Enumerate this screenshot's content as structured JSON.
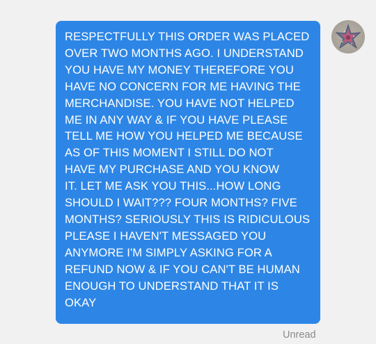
{
  "conversation": {
    "message": {
      "lines": [
        "RESPECTFULLY THIS ORDER WAS PLACED",
        "OVER TWO MONTHS AGO. I UNDERSTAND",
        "YOU HAVE MY MONEY THEREFORE YOU",
        "HAVE NO CONCERN FOR ME HAVING THE",
        "MERCHANDISE. YOU HAVE NOT HELPED",
        "ME IN ANY WAY & IF YOU HAVE PLEASE",
        "TELL ME HOW YOU HELPED ME BECAUSE",
        "AS OF THIS MOMENT I STILL DO NOT",
        "HAVE MY PURCHASE AND YOU KNOW",
        "IT. LET ME ASK YOU THIS...HOW LONG",
        "SHOULD I WAIT??? FOUR MONTHS? FIVE",
        "MONTHS? SERIOUSLY THIS IS RIDICULOUS",
        "PLEASE I HAVEN'T MESSAGED YOU",
        "ANYMORE I'M SIMPLY ASKING FOR A",
        "REFUND NOW & IF YOU CAN'T BE HUMAN",
        "ENOUGH TO UNDERSTAND THAT IT IS",
        "OKAY"
      ],
      "status": "Unread"
    },
    "avatar": {
      "icon": "starfish-avatar-icon"
    }
  },
  "colors": {
    "background": "#f1f1f1",
    "bubble": "#2d86e6",
    "bubble_text": "#ffffff",
    "status_text": "#8a8a8a"
  }
}
